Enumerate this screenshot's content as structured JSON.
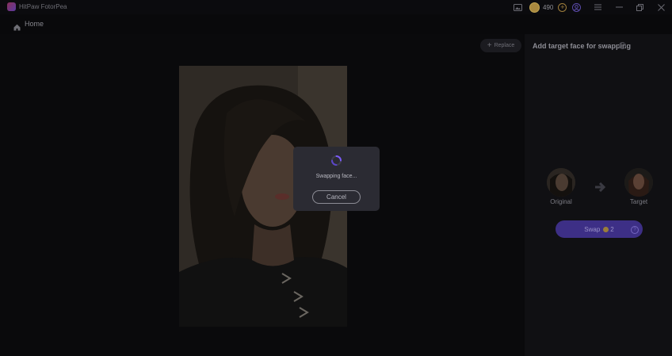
{
  "app": {
    "title": "HitPaw FotorPea"
  },
  "titlebar": {
    "coins": "490"
  },
  "nav": {
    "home_label": "Home"
  },
  "canvas": {
    "replace_label": "Replace"
  },
  "panel": {
    "title": "Add target face for swapping",
    "original_label": "Original",
    "target_label": "Target",
    "swap_label": "Swap",
    "swap_cost": "2"
  },
  "modal": {
    "status_text": "Swapping face...",
    "cancel_label": "Cancel"
  },
  "colors": {
    "accent": "#3d2f86",
    "coin": "#a9893f",
    "background": "#09090b"
  }
}
